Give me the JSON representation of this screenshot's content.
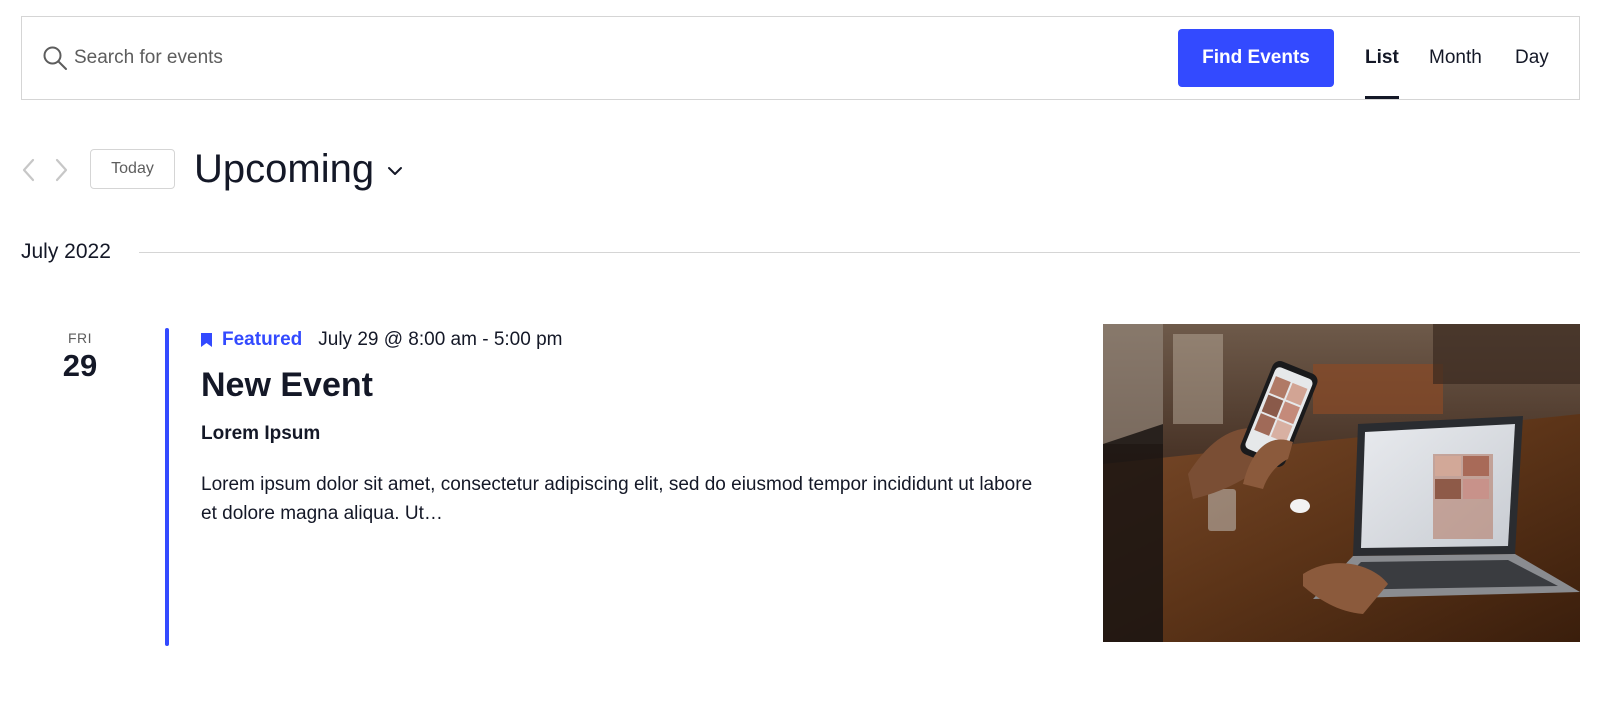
{
  "search": {
    "placeholder": "Search for events",
    "icon": "search-icon",
    "button_label": "Find Events"
  },
  "views": {
    "tabs": [
      {
        "label": "List",
        "active": true
      },
      {
        "label": "Month",
        "active": false
      },
      {
        "label": "Day",
        "active": false
      }
    ]
  },
  "nav": {
    "today_label": "Today",
    "period_label": "Upcoming",
    "period_icon": "chevron-down-icon"
  },
  "month_separator": {
    "label": "July 2022"
  },
  "event": {
    "weekday": "FRI",
    "day": "29",
    "featured_label": "Featured",
    "datetime": "July 29 @ 8:00 am - 5:00 pm",
    "title": "New Event",
    "venue": "Lorem Ipsum",
    "description": "Lorem ipsum dolor sit amet, consectetur adipiscing elit, sed do eiusmod tempor incididunt ut labore et dolore magna aliqua. Ut…"
  },
  "colors": {
    "accent": "#334aff",
    "text": "#141827",
    "muted": "#5d5d5d",
    "border": "#d5d5d5"
  }
}
